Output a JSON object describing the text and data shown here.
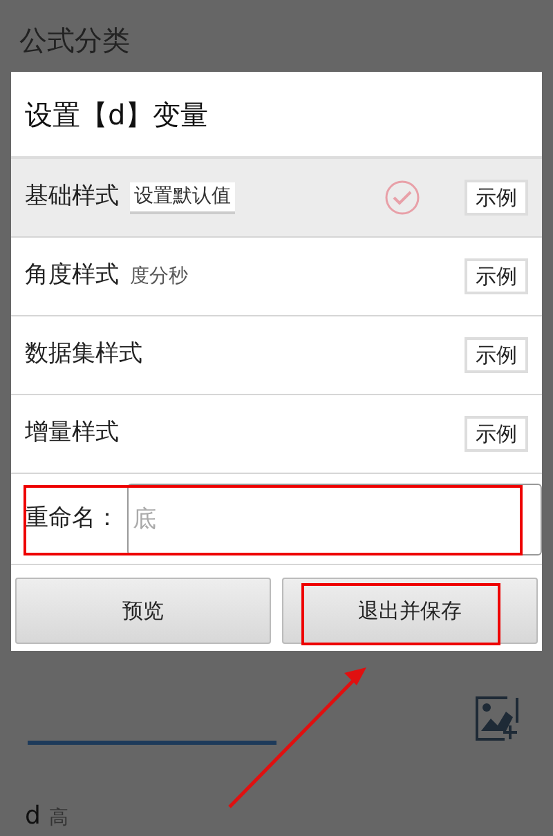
{
  "background": {
    "title": "公式分类",
    "item_label": "d",
    "item_value": "高"
  },
  "dialog": {
    "title": "设置【d】变量",
    "rows": [
      {
        "label": "基础样式",
        "value": "设置默认值",
        "kind": "field",
        "selected": true,
        "checked": true,
        "example": "示例"
      },
      {
        "label": "角度样式",
        "value": "度分秒",
        "kind": "text",
        "selected": false,
        "checked": false,
        "example": "示例"
      },
      {
        "label": "数据集样式",
        "selected": false,
        "checked": false,
        "example": "示例"
      },
      {
        "label": "增量样式",
        "selected": false,
        "checked": false,
        "example": "示例"
      }
    ],
    "rename": {
      "label": "重命名：",
      "placeholder": "底",
      "highlighted": true
    },
    "buttons": [
      {
        "label": "预览",
        "highlighted": false
      },
      {
        "label": "退出并保存",
        "highlighted": true
      }
    ]
  }
}
